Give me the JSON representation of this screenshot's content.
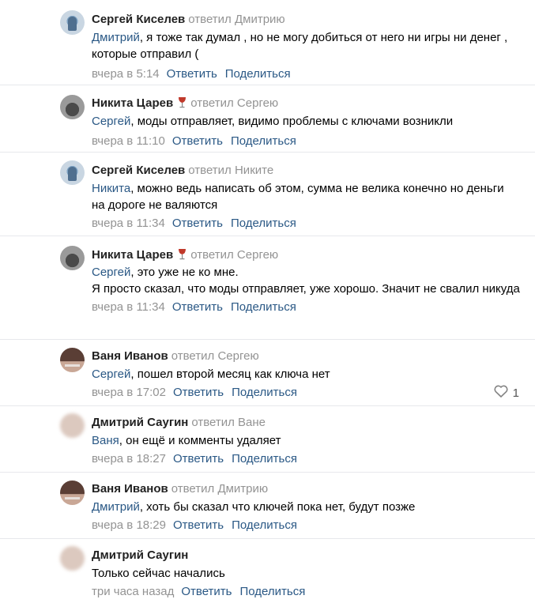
{
  "comments": [
    {
      "author": "Сергей Киселев",
      "replied_to": "ответил Дмитрию",
      "addressee": "Дмитрий",
      "text": ", я тоже так думал , но не могу добиться от него ни игры ни денег , которые отправил (",
      "time": "вчера в 5:14",
      "reply_label": "Ответить",
      "share_label": "Поделиться"
    },
    {
      "author": "Никита Царев",
      "replied_to": "ответил Сергею",
      "addressee": "Сергей",
      "text": ", моды отправляет, видимо проблемы с ключами возникли",
      "time": "вчера в 11:10",
      "reply_label": "Ответить",
      "share_label": "Поделиться"
    },
    {
      "author": "Сергей Киселев",
      "replied_to": "ответил Никите",
      "addressee": "Никита",
      "text": ", можно ведь написать об этом, сумма не велика конечно но деньги на дороге не валяются",
      "time": "вчера в 11:34",
      "reply_label": "Ответить",
      "share_label": "Поделиться"
    },
    {
      "author": "Никита Царев",
      "replied_to": "ответил Сергею",
      "addressee": "Сергей",
      "text": ", это уже не ко мне.",
      "text2": "Я просто сказал, что моды отправляет, уже хорошо. Значит не свалил никуда",
      "time": "вчера в 11:34",
      "reply_label": "Ответить",
      "share_label": "Поделиться"
    },
    {
      "author": "Ваня Иванов",
      "replied_to": "ответил Сергею",
      "addressee": "Сергей",
      "text": ", пошел второй месяц как ключа нет",
      "time": "вчера в 17:02",
      "reply_label": "Ответить",
      "share_label": "Поделиться",
      "likes": "1"
    },
    {
      "author": "Дмитрий Саугин",
      "replied_to": "ответил Ване",
      "addressee": "Ваня",
      "text": ", он ещё и комменты удаляет",
      "time": "вчера в 18:27",
      "reply_label": "Ответить",
      "share_label": "Поделиться"
    },
    {
      "author": "Ваня Иванов",
      "replied_to": "ответил Дмитрию",
      "addressee": "Дмитрий",
      "text": ", хоть бы сказал что ключей пока нет, будут позже",
      "time": "вчера в 18:29",
      "reply_label": "Ответить",
      "share_label": "Поделиться"
    },
    {
      "author": "Дмитрий Саугин",
      "text": "Только сейчас начались",
      "time": "три часа назад",
      "reply_label": "Ответить",
      "share_label": "Поделиться"
    }
  ],
  "colors": {
    "link": "#2a5885",
    "muted": "#939393",
    "divider": "#e7e8ec",
    "wine_icon": "#c0392b"
  },
  "icons": {
    "author_badge": "wine-glass-icon",
    "like": "heart-outline-icon"
  }
}
